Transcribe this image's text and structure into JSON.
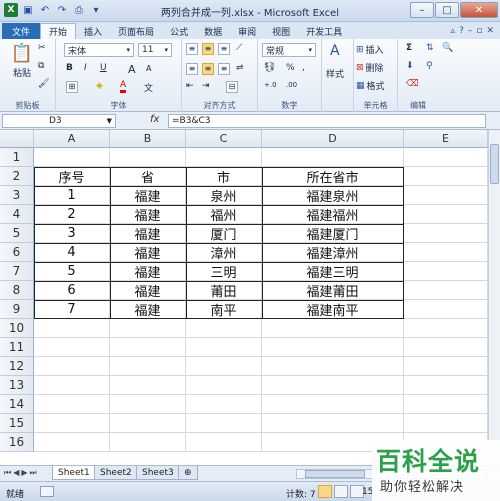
{
  "title_bar": {
    "title": "两列合并成一列.xlsx - Microsoft Excel",
    "app_icon": "X",
    "minimize": "–",
    "maximize": "□",
    "close": "✕"
  },
  "ribbon_tabs": [
    "文件",
    "开始",
    "插入",
    "页面布局",
    "公式",
    "数据",
    "审阅",
    "视图",
    "开发工具"
  ],
  "ribbon": {
    "clipboard": {
      "paste": "粘贴",
      "label": "剪贴板"
    },
    "font": {
      "name": "宋体",
      "size": "11",
      "bold": "B",
      "italic": "I",
      "underline": "U",
      "grow": "A",
      "shrink": "A",
      "font_color": "A",
      "label": "字体"
    },
    "alignment": {
      "label": "对齐方式"
    },
    "number": {
      "format": "常规",
      "percent": "%",
      "comma": ",",
      "label": "数字"
    },
    "styles": {
      "label": "样式",
      "group_label": "A"
    },
    "cells": {
      "insert": "插入",
      "delete": "删除",
      "format": "格式",
      "label": "单元格"
    },
    "editing": {
      "sum": "Σ",
      "label": "编辑"
    }
  },
  "formula_bar": {
    "name_box": "D3",
    "fx": "fx",
    "formula": "=B3&C3"
  },
  "grid": {
    "columns": [
      "A",
      "B",
      "C",
      "D",
      "E"
    ],
    "rows": [
      "1",
      "2",
      "3",
      "4",
      "5",
      "6",
      "7",
      "8",
      "9",
      "10",
      "11",
      "12",
      "13",
      "14",
      "15",
      "16"
    ],
    "table": {
      "header": [
        "序号",
        "省",
        "市",
        "所在省市"
      ],
      "rows": [
        [
          "1",
          "福建",
          "泉州",
          "福建泉州"
        ],
        [
          "2",
          "福建",
          "福州",
          "福建福州"
        ],
        [
          "3",
          "福建",
          "厦门",
          "福建厦门"
        ],
        [
          "4",
          "福建",
          "漳州",
          "福建漳州"
        ],
        [
          "5",
          "福建",
          "三明",
          "福建三明"
        ],
        [
          "6",
          "福建",
          "莆田",
          "福建莆田"
        ],
        [
          "7",
          "福建",
          "南平",
          "福建南平"
        ]
      ]
    }
  },
  "sheet_tabs": [
    "Sheet1",
    "Sheet2",
    "Sheet3"
  ],
  "status_bar": {
    "ready": "就绪",
    "count": "计数: 7",
    "zoom": "15"
  },
  "watermark": {
    "big": "百科全说",
    "small": "助你轻松解决"
  }
}
